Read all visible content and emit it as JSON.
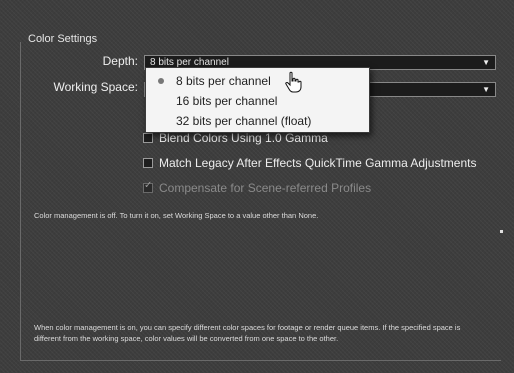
{
  "section_title": "Color Settings",
  "depth": {
    "label": "Depth:",
    "value": "8 bits per channel",
    "options": [
      "8 bits per channel",
      "16 bits per channel",
      "32 bits per channel (float)"
    ],
    "selected_index": 0
  },
  "working_space": {
    "label": "Working Space:",
    "value": ""
  },
  "checkboxes": {
    "blend_colors": "Blend Colors Using 1.0 Gamma",
    "match_legacy": "Match Legacy After Effects QuickTime Gamma Adjustments",
    "compensate": "Compensate for Scene-referred Profiles"
  },
  "info_off": "Color management is off. To turn it on, set Working Space to a value other than None.",
  "info_on": "When color management is on, you can specify different color spaces for footage or render queue items. If the specified space is different from the working space, color values will be converted from one space to the other.",
  "icons": [
    "chevron-down-icon",
    "hand-pointer-cursor-icon",
    "checkmark-icon",
    "radio-bullet-icon"
  ]
}
